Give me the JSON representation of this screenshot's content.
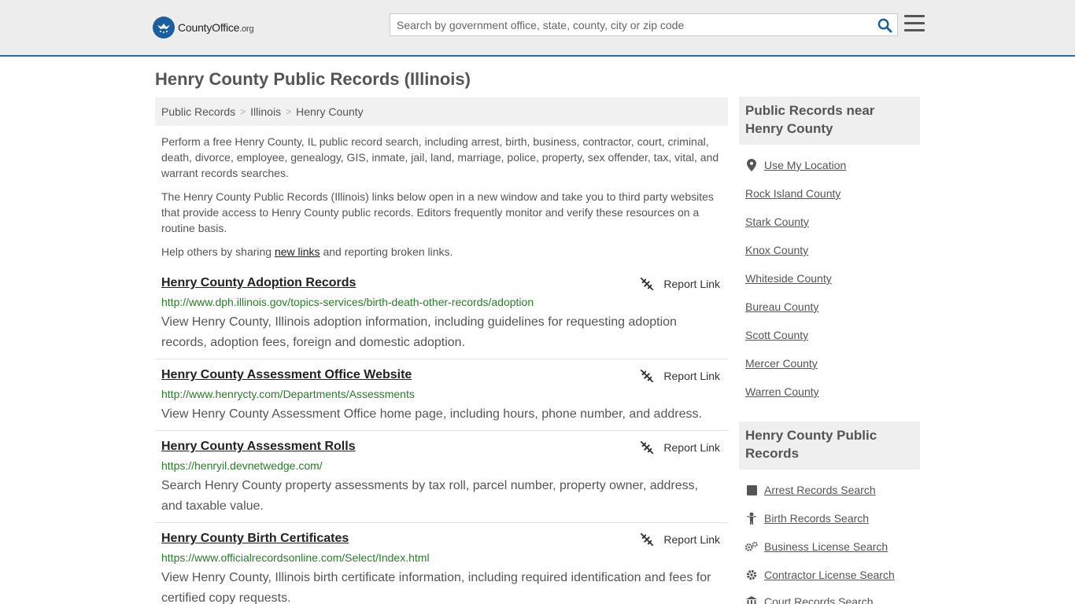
{
  "header": {
    "logo_text_main": "CountyOffice",
    "logo_text_suffix": ".org",
    "search_placeholder": "Search by government office, state, county, city or zip code"
  },
  "page": {
    "title": "Henry County Public Records (Illinois)"
  },
  "breadcrumb": [
    "Public Records",
    "Illinois",
    "Henry County"
  ],
  "intro": {
    "p1": "Perform a free Henry County, IL public record search, including arrest, birth, business, contractor, court, criminal, death, divorce, employee, genealogy, GIS, inmate, jail, land, marriage, police, property, sex offender, tax, vital, and warrant records searches.",
    "p2": "The Henry County Public Records (Illinois) links below open in a new window and take you to third party websites that provide access to Henry County public records. Editors frequently monitor and verify these resources on a routine basis.",
    "p3_before": "Help others by sharing ",
    "p3_link": "new links",
    "p3_after": " and reporting broken links."
  },
  "report_label": "Report Link",
  "records": [
    {
      "title": "Henry County Adoption Records",
      "url": "http://www.dph.illinois.gov/topics-services/birth-death-other-records/adoption",
      "desc": "View Henry County, Illinois adoption information, including guidelines for requesting adoption records, adoption fees, foreign and domestic adoption."
    },
    {
      "title": "Henry County Assessment Office Website",
      "url": "http://www.henrycty.com/Departments/Assessments",
      "desc": "View Henry County Assessment Office home page, including hours, phone number, and address."
    },
    {
      "title": "Henry County Assessment Rolls",
      "url": "https://henryil.devnetwedge.com/",
      "desc": "Search Henry County property assessments by tax roll, parcel number, property owner, address, and taxable value."
    },
    {
      "title": "Henry County Birth Certificates",
      "url": "https://www.officialrecordsonline.com/Select/Index.html",
      "desc": "View Henry County, Illinois birth certificate information, including required identification and fees for certified copy requests."
    }
  ],
  "sidebar": {
    "nearby_heading": "Public Records near Henry County",
    "use_location": "Use My Location",
    "nearby": [
      "Rock Island County",
      "Stark County",
      "Knox County",
      "Whiteside County",
      "Bureau County",
      "Scott County",
      "Mercer County",
      "Warren County"
    ],
    "records_heading": "Henry County Public Records",
    "record_links": [
      {
        "label": "Arrest Records Search",
        "icon": "square-icon"
      },
      {
        "label": "Birth Records Search",
        "icon": "baby-icon"
      },
      {
        "label": "Business License Search",
        "icon": "cogs-icon"
      },
      {
        "label": "Contractor License Search",
        "icon": "gear-icon"
      },
      {
        "label": "Court Records Search",
        "icon": "courthouse-icon"
      }
    ]
  },
  "colors": {
    "accent_blue": "#2c6aa5",
    "url_green": "#2c7a2c",
    "header_bg": "#ededed"
  }
}
